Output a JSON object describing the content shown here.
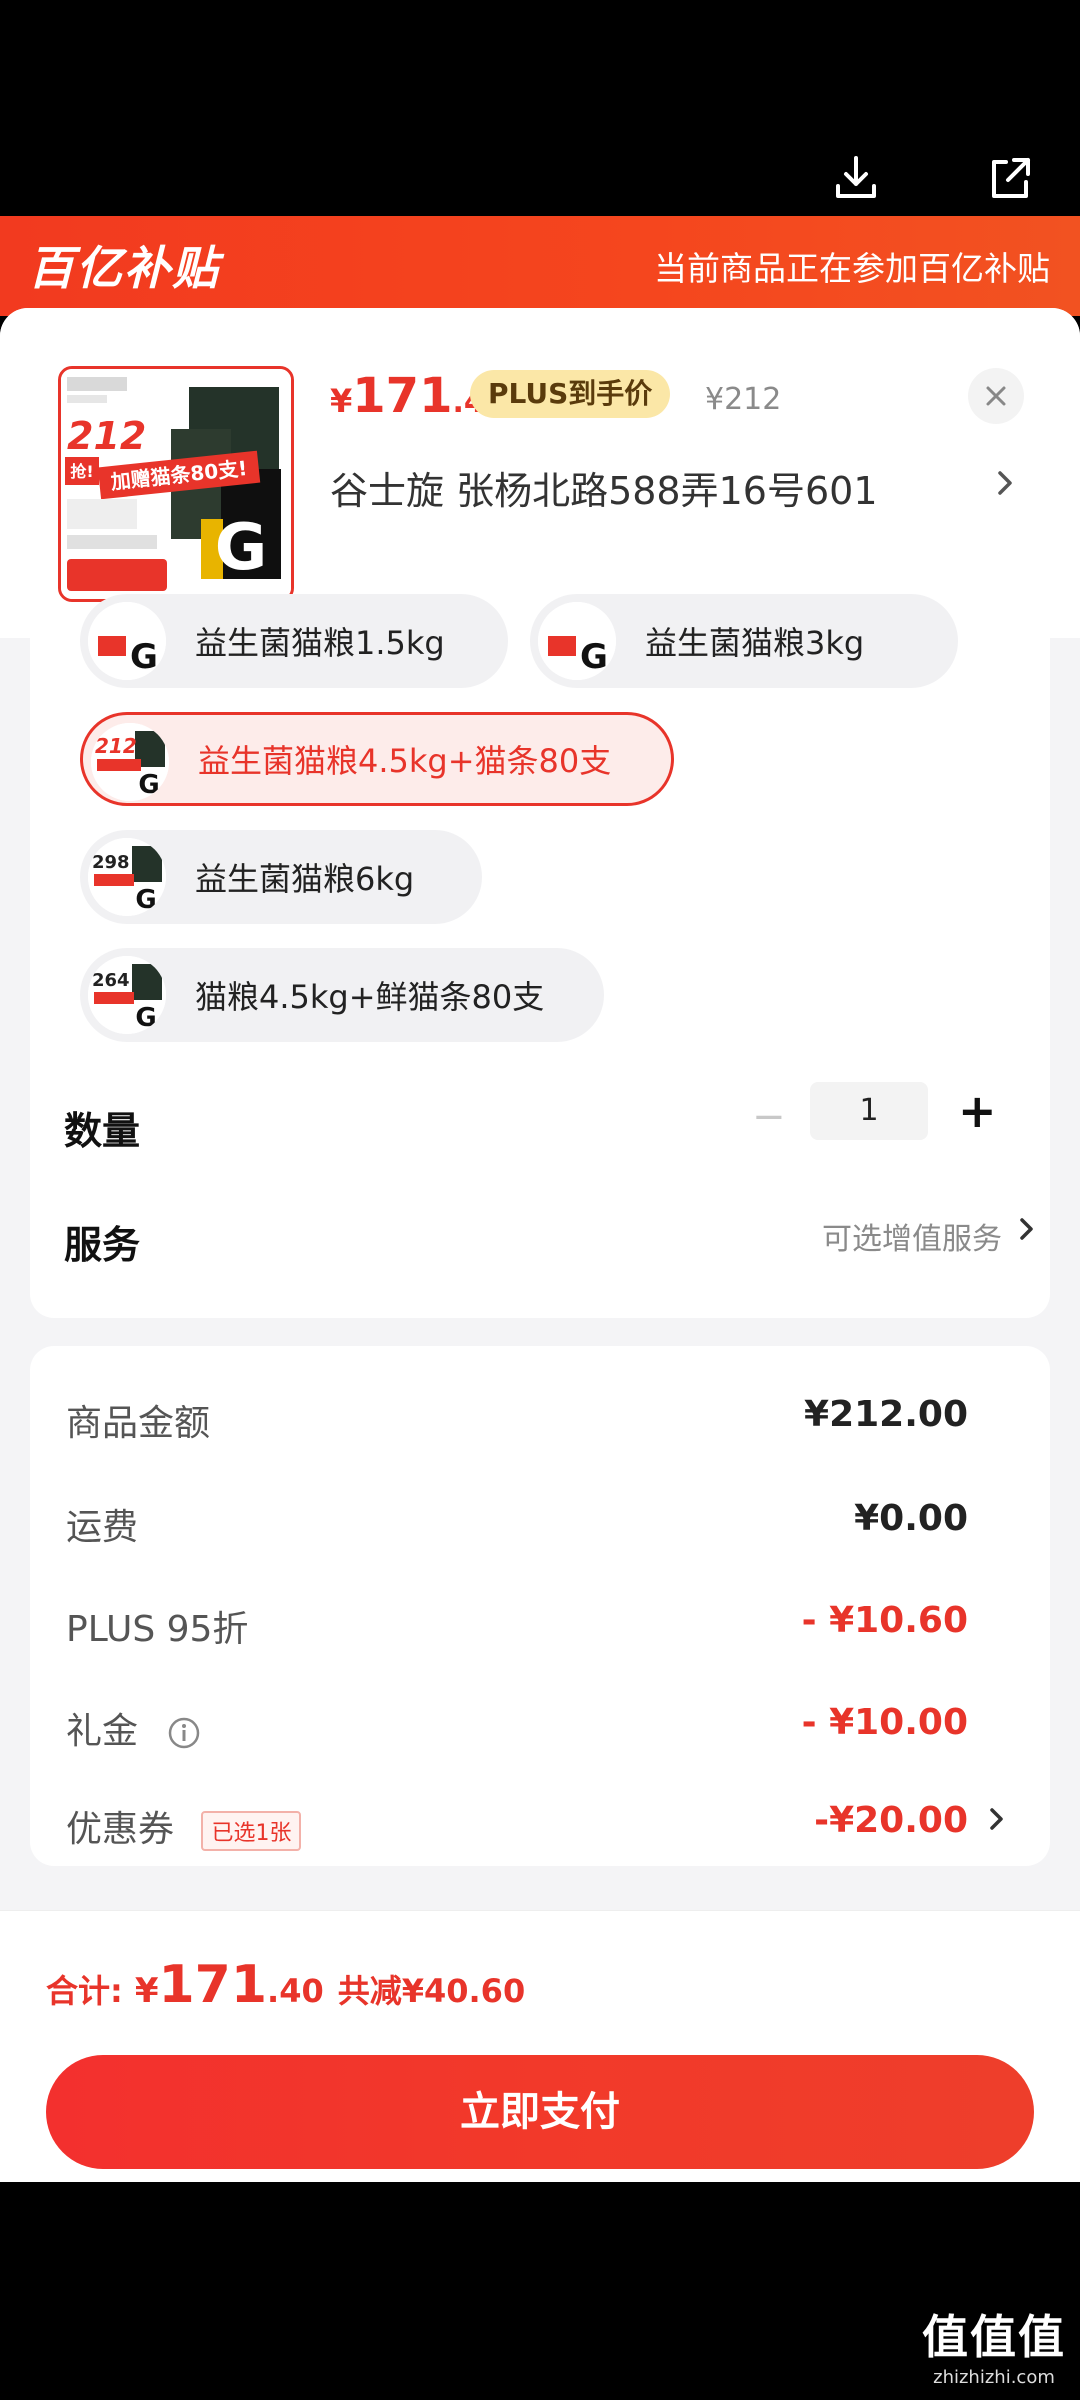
{
  "banner": {
    "logo": "百亿补贴",
    "notice": "当前商品正在参加百亿补贴"
  },
  "product": {
    "price_symbol": "¥",
    "price_int": "171",
    "price_dec": ".4",
    "plus_badge": "PLUS到手价",
    "original_price": "¥212",
    "address": "谷士旋  张杨北路588弄16号601",
    "thumb_text": {
      "price": "212",
      "promo": "加赠猫条80支!",
      "grab": "抢!"
    }
  },
  "options": [
    {
      "label": "益生菌猫粮1.5kg",
      "selected": false
    },
    {
      "label": "益生菌猫粮3kg",
      "selected": false
    },
    {
      "label": "益生菌猫粮4.5kg+猫条80支",
      "selected": true
    },
    {
      "label": "益生菌猫粮6kg",
      "selected": false
    },
    {
      "label": "猫粮4.5kg+鲜猫条80支",
      "selected": false
    }
  ],
  "option_thumb_prices": {
    "opt2": "212",
    "opt3": "298",
    "opt4": "264"
  },
  "quantity": {
    "label": "数量",
    "minus": "−",
    "value": "1",
    "plus": "+"
  },
  "service": {
    "label": "服务",
    "value": "可选增值服务"
  },
  "summary": {
    "goods_label": "商品金额",
    "goods_value": "¥212.00",
    "shipping_label": "运费",
    "shipping_value": "¥0.00",
    "plus_label": "PLUS 95折",
    "plus_value": "- ¥10.60",
    "gift_label": "礼金",
    "gift_value": "- ¥10.00",
    "coupon_label": "优惠券",
    "coupon_tag": "已选1张",
    "coupon_value": "-¥20.00"
  },
  "footer": {
    "total_label": "合计:",
    "total_symbol": "¥",
    "total_int": "171",
    "total_dec": ".40",
    "saved": "共减¥40.60",
    "pay_button": "立即支付"
  },
  "watermark": {
    "top": "值值值",
    "bottom": "zhizhizhi.com"
  },
  "colors": {
    "accent": "#e8342a",
    "banner": "#f23a1f",
    "plus_badge_bg": "#fbe7a7"
  }
}
